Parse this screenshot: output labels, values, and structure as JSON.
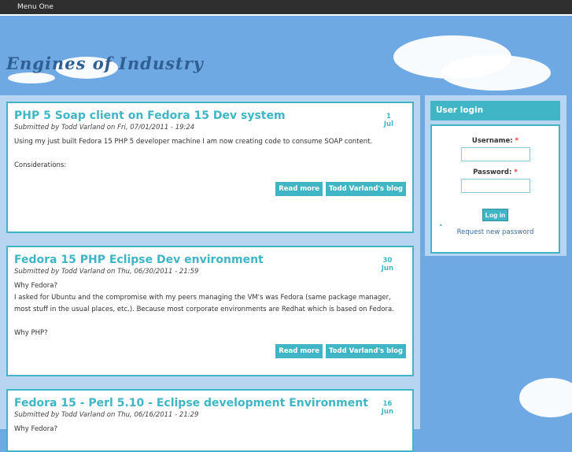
{
  "nav": {
    "menu_one": "Menu One"
  },
  "site": {
    "title": "Engines of Industry"
  },
  "posts": [
    {
      "title": "PHP 5 Soap client on Fedora 15 Dev system",
      "meta": "Submitted by Todd Varland on Fri, 07/01/2011 - 19:24",
      "day": "1",
      "month": "Jul",
      "body": [
        "Using my just built Fedora 15 PHP 5 developer machine I am now creating code to consume SOAP content.",
        "Considerations:"
      ],
      "read_more": "Read more",
      "blog": "Todd Varland's blog"
    },
    {
      "title": "Fedora 15 PHP Eclipse Dev environment",
      "meta": "Submitted by Todd Varland on Thu, 06/30/2011 - 21:59",
      "day": "30",
      "month": "Jun",
      "body": [
        "Why Fedora?",
        "I asked for Ubuntu and the compromise with my peers managing the VM's was Fedora (same package manager, most stuff in the usual places, etc.).  Because most corporate environments are Redhat which is based on Fedora.",
        "Why PHP?"
      ],
      "read_more": "Read more",
      "blog": "Todd Varland's blog"
    },
    {
      "title": "Fedora 15 - Perl 5.10 - Eclipse development Environment",
      "meta": "Submitted by Todd Varland on Thu, 06/16/2011 - 21:29",
      "day": "16",
      "month": "Jun",
      "body": [
        "Why Fedora?"
      ]
    }
  ],
  "login": {
    "title": "User login",
    "username_label": "Username:",
    "password_label": "Password:",
    "required": "*",
    "username": "",
    "password": "",
    "submit": "Log in",
    "request_password": "Request new password"
  }
}
